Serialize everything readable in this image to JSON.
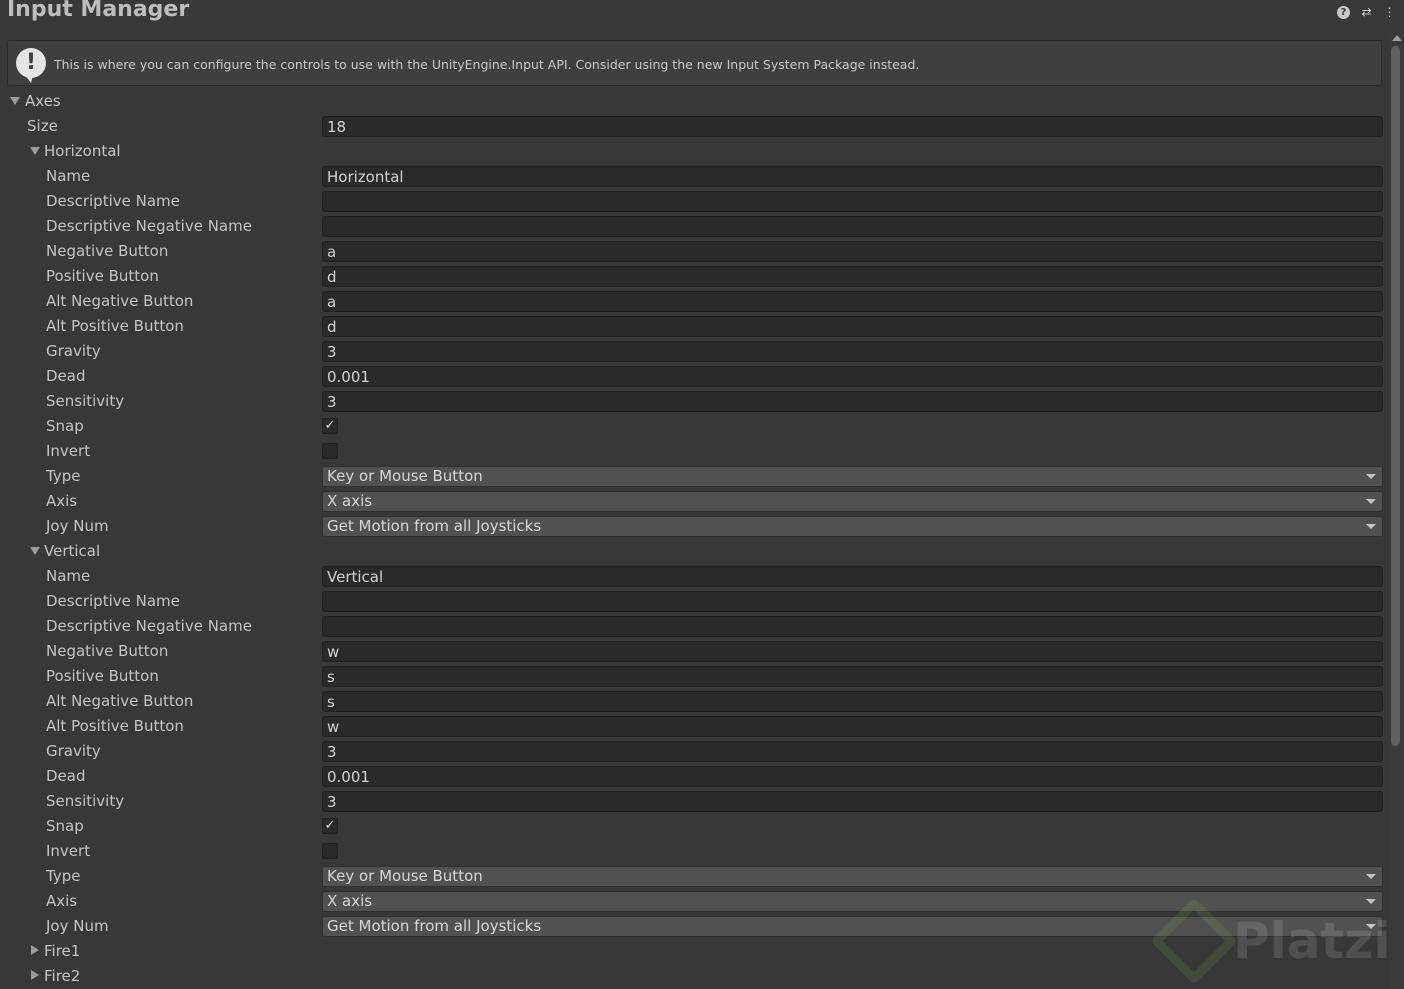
{
  "window": {
    "title": "Input Manager"
  },
  "header_icons": [
    "help-icon",
    "preset-icon",
    "more-vertical-icon"
  ],
  "help": {
    "text": "This is where you can configure the controls to use with the UnityEngine.Input API. Consider using the new Input System Package instead."
  },
  "axes": {
    "label": "Axes",
    "size_label": "Size",
    "size_value": "18"
  },
  "horizontal": {
    "header": "Horizontal",
    "fields": [
      {
        "label": "Name",
        "value": "Horizontal"
      },
      {
        "label": "Descriptive Name",
        "value": ""
      },
      {
        "label": "Descriptive Negative Name",
        "value": ""
      },
      {
        "label": "Negative Button",
        "value": "a"
      },
      {
        "label": "Positive Button",
        "value": "d"
      },
      {
        "label": "Alt Negative Button",
        "value": "a"
      },
      {
        "label": "Alt Positive Button",
        "value": "d"
      },
      {
        "label": "Gravity",
        "value": "3"
      },
      {
        "label": "Dead",
        "value": "0.001"
      },
      {
        "label": "Sensitivity",
        "value": "3"
      }
    ],
    "snap": {
      "label": "Snap",
      "checked": true
    },
    "invert": {
      "label": "Invert",
      "checked": false
    },
    "type": {
      "label": "Type",
      "value": "Key or Mouse Button"
    },
    "axis": {
      "label": "Axis",
      "value": "X axis"
    },
    "joy_num": {
      "label": "Joy Num",
      "value": "Get Motion from all Joysticks"
    }
  },
  "vertical": {
    "header": "Vertical",
    "fields": [
      {
        "label": "Name",
        "value": "Vertical"
      },
      {
        "label": "Descriptive Name",
        "value": ""
      },
      {
        "label": "Descriptive Negative Name",
        "value": ""
      },
      {
        "label": "Negative Button",
        "value": "w"
      },
      {
        "label": "Positive Button",
        "value": "s"
      },
      {
        "label": "Alt Negative Button",
        "value": "s"
      },
      {
        "label": "Alt Positive Button",
        "value": "w"
      },
      {
        "label": "Gravity",
        "value": "3"
      },
      {
        "label": "Dead",
        "value": "0.001"
      },
      {
        "label": "Sensitivity",
        "value": "3"
      }
    ],
    "snap": {
      "label": "Snap",
      "checked": true
    },
    "invert": {
      "label": "Invert",
      "checked": false
    },
    "type": {
      "label": "Type",
      "value": "Key or Mouse Button"
    },
    "axis": {
      "label": "Axis",
      "value": "X axis"
    },
    "joy_num": {
      "label": "Joy Num",
      "value": "Get Motion from all Joysticks"
    }
  },
  "collapsed_axes": [
    "Fire1",
    "Fire2"
  ],
  "checkmark_glyph": "✓",
  "watermark": {
    "text": "Platzi",
    "color": "#8fd14f"
  }
}
